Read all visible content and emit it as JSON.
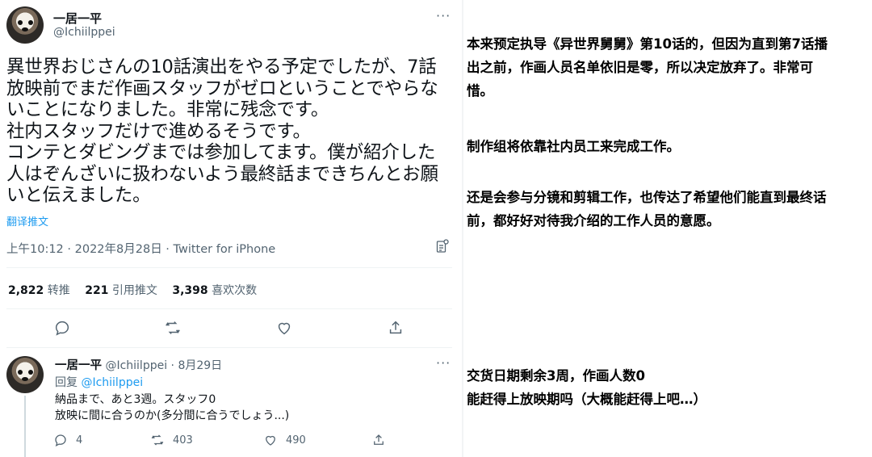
{
  "tweet": {
    "author_name": "一居一平",
    "author_handle": "@Ichiilppei",
    "more_label": "···",
    "text_lines": [
      "異世界おじさんの10話演出をやる予定でしたが、7話",
      "放映前でまだ作画スタッフがゼロということでやらな",
      "いことになりました。非常に残念です。",
      "社内スタッフだけで進めるそうです。",
      "コンテとダビングまでは参加してます。僕が紹介した",
      "人はぞんざいに扱わないよう最終話まできちんとお願",
      "いと伝えました。"
    ],
    "translate_label": "翻译推文",
    "timestamp": "上午10:12 · 2022年8月28日 · Twitter for iPhone",
    "stats": [
      {
        "count": "2,822",
        "label": "转推"
      },
      {
        "count": "221",
        "label": "引用推文"
      },
      {
        "count": "3,398",
        "label": "喜欢次数"
      }
    ]
  },
  "reply": {
    "author_name": "一居一平",
    "meta": "@Ichiilppei · 8月29日",
    "more_label": "···",
    "replying_prefix": "回复 ",
    "replying_handle": "@Ichiilppei",
    "text_lines": [
      "納品まで、あと3週。スタッフ0",
      "放映に間に合うのか(多分間に合うでしょう...)"
    ],
    "reply_count": "4",
    "retweet_count": "403",
    "like_count": "490"
  },
  "translation": {
    "block1": [
      "本来预定执导《异世界舅舅》第10话的，但因为直到第7话播",
      "出之前，作画人员名单依旧是零，所以决定放弃了。非常可",
      "惜。"
    ],
    "block2": [
      "制作组将依靠社内员工来完成工作。"
    ],
    "block3": [
      "还是会参与分镜和剪辑工作，也传达了希望他们能直到最终话",
      "前，都好好对待我介绍的工作人员的意愿。"
    ],
    "block4": [
      "交货日期剩余3周，作画人数0",
      "能赶得上放映期吗（大概能赶得上吧…）"
    ]
  },
  "icons": [
    "reply-icon",
    "retweet-icon",
    "like-icon",
    "share-icon",
    "analytics-icon",
    "more-icon"
  ],
  "colors": {
    "link": "#1d9bf0",
    "secondary": "#536471",
    "text": "#0f1419"
  }
}
